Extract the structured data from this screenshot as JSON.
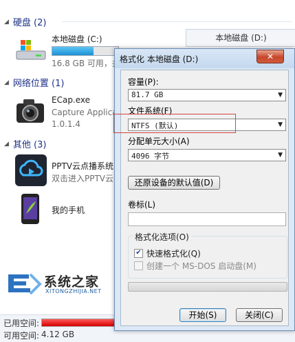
{
  "explorer": {
    "groups": {
      "hdd": {
        "title": "硬盘 (2)"
      },
      "network": {
        "title": "网络位置 (1)"
      },
      "other": {
        "title": "其他 (3)"
      }
    },
    "drive_c": {
      "name": "本地磁盘 (C:)",
      "detail": "16.8 GB 可用，共",
      "fill_fraction": 0.62
    },
    "drive_d": {
      "name": "本地磁盘 (D:)"
    },
    "ecap": {
      "name": "ECap.exe",
      "desc": "Capture Applica",
      "version": "1.0.1.4"
    },
    "pptv": {
      "name": "PPTV云点播系统",
      "desc": "双击进入PPTV云"
    },
    "phone": {
      "name": "我的手机"
    },
    "status": {
      "used_label": "已用空间:",
      "free_label": "可用空间:",
      "free_value": "4.12 GB",
      "used_fraction": 0.95
    }
  },
  "dialog": {
    "title": "格式化 本地磁盘 (D:)",
    "close_label": "✕",
    "capacity": {
      "label": "容量(P):",
      "value": "81.7 GB"
    },
    "filesystem": {
      "label": "文件系统(F)",
      "value": "NTFS (默认)"
    },
    "alloc": {
      "label": "分配单元大小(A)",
      "value": "4096 字节"
    },
    "restore_label": "还原设备的默认值(D)",
    "volume": {
      "label": "卷标(L)",
      "value": ""
    },
    "options": {
      "legend": "格式化选项(O)",
      "quick": {
        "label": "快速格式化(Q)",
        "checked": true
      },
      "msdos": {
        "label": "创建一个 MS-DOS 启动盘(M)",
        "checked": false
      }
    },
    "progress_fraction": 0,
    "start_label": "开始(S)",
    "close_button_label": "关闭(C)"
  },
  "watermark": {
    "cn": "系统之家",
    "en": "XITONGZHIJIA.NET"
  },
  "colors": {
    "accent": "#1e3287",
    "highlight": "#d4443c",
    "used_bar": "#d40000"
  }
}
